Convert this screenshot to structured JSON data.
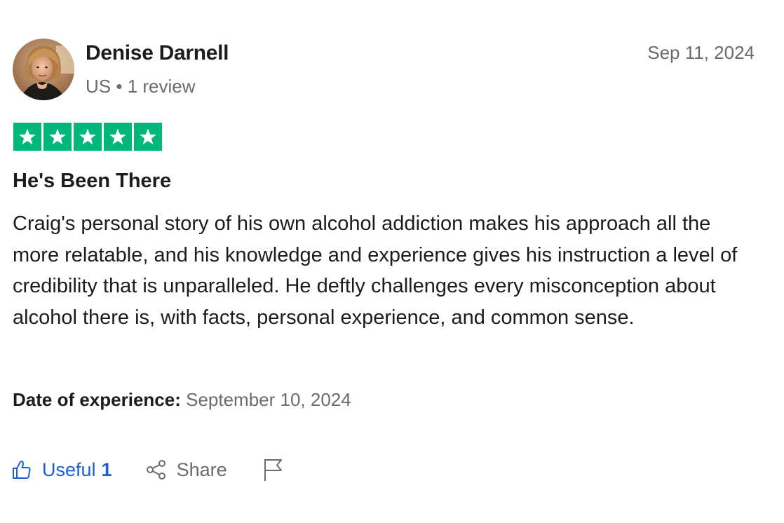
{
  "reviewer": {
    "name": "Denise Darnell",
    "country": "US",
    "separator": "•",
    "review_count": "1 review"
  },
  "review": {
    "date": "Sep 11, 2024",
    "rating": 5,
    "rating_max": 5,
    "title": "He's Been There",
    "body": "Craig's personal story of his own alcohol addiction makes his approach all the more relatable, and his knowledge and experience gives his instruction a level of credibility that is unparalleled. He deftly challenges every misconception about alcohol there is, with facts, personal experience, and common sense.",
    "experience_label": "Date of experience:",
    "experience_date": "September 10, 2024"
  },
  "actions": {
    "useful_label": "Useful",
    "useful_count": "1",
    "share_label": "Share"
  },
  "icons": {
    "useful": "thumbs-up-icon",
    "share": "share-icon",
    "report": "flag-icon",
    "star": "star-icon"
  },
  "colors": {
    "star_green": "#00b67a",
    "link_blue": "#1d5ed8",
    "muted_gray": "#6b6b6b",
    "text_dark": "#1c1c1c"
  }
}
